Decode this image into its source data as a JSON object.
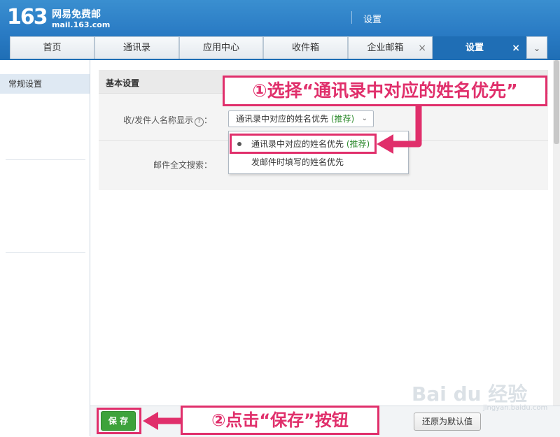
{
  "header": {
    "logo_number": "163",
    "logo_brand": "网易免费邮",
    "logo_url": "mail.163.com",
    "title": "设置"
  },
  "tabs": [
    {
      "label": "首页",
      "closable": false
    },
    {
      "label": "通讯录",
      "closable": false
    },
    {
      "label": "应用中心",
      "closable": false
    },
    {
      "label": "收件箱",
      "closable": false
    },
    {
      "label": "企业邮箱",
      "closable": true
    },
    {
      "label": "设置",
      "closable": true,
      "active": true
    }
  ],
  "tab_close_glyph": "×",
  "tab_more_glyph": "⌄",
  "sidebar": {
    "items": [
      {
        "label": "常规设置",
        "selected": true
      }
    ]
  },
  "settings": {
    "section_title": "基本设置",
    "sender_name_label": "收/发件人名称显示",
    "help_glyph": "?",
    "colon": "：",
    "selected_value": "通讯录中对应的姓名优先",
    "selected_tag": "(推荐)",
    "fulltext_label": "邮件全文搜索："
  },
  "dropdown": {
    "options": [
      {
        "label": "通讯录中对应的姓名优先",
        "tag": "(推荐)",
        "selected": true
      },
      {
        "label": "发邮件时填写的姓名优先",
        "tag": "",
        "selected": false
      }
    ]
  },
  "footer": {
    "save_label": "保 存",
    "reset_label": "还原为默认值"
  },
  "annotations": {
    "step1": "①选择“通讯录中对应的姓名优先”",
    "step2": "②点击“保存”按钮",
    "accent_color": "#e02f6b"
  },
  "watermark": {
    "text": "Bai du 经验",
    "sub": "jingyan.baidu.com"
  },
  "colors": {
    "header_blue": "#2a7bc4",
    "active_tab": "#1f6eb5",
    "save_green": "#3da23b",
    "recommend_green": "#2e8b2e"
  }
}
